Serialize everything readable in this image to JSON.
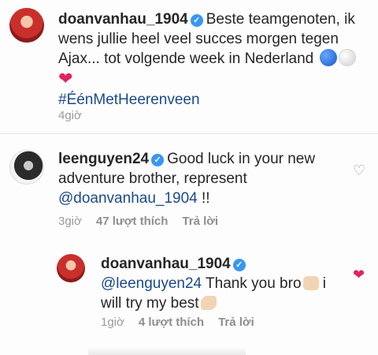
{
  "post": {
    "username": "doanvanhau_1904",
    "caption_line1": "Beste teamgenoten, ik",
    "caption_line2": "wens jullie heel veel succes morgen tegen",
    "caption_line3": "Ajax... tot volgende week in Nederland",
    "hashtag": "#ÉénMetHeerenveen",
    "time": "4giờ"
  },
  "comment": {
    "username": "leenguyen24",
    "text_line1": "Good luck in your new",
    "text_line2": "adventure brother, represent",
    "mention": "@doanvanhau_1904",
    "text_tail": " !!",
    "time": "3giờ",
    "likes": "47 lượt thích",
    "reply": "Trả lời"
  },
  "reply": {
    "username": "doanvanhau_1904",
    "mention": "@leenguyen24",
    "text_line1": " Thank you bro",
    "text_line2_a": " i",
    "text_line3": "will try my best",
    "time": "1giờ",
    "likes": "4 lượt thích",
    "reply": "Trả lời"
  },
  "colors": {
    "verified": "#3897f0",
    "link": "#1b4a8a",
    "liked_heart": "#e0245e",
    "meta": "#9a9a9a"
  }
}
